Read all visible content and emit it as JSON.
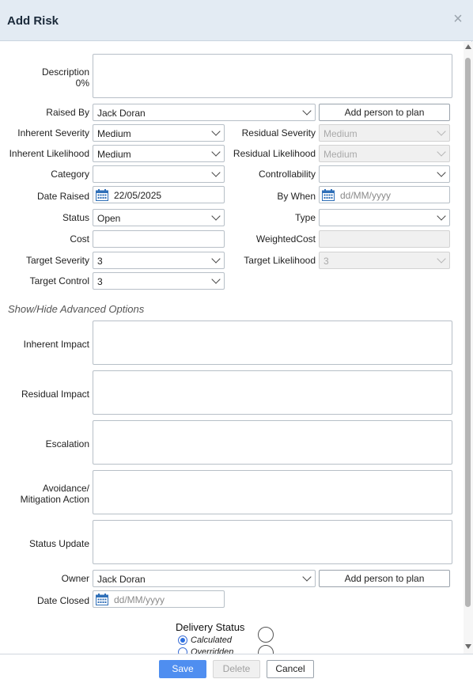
{
  "dialog": {
    "title": "Add Risk",
    "close_glyph": "×"
  },
  "form": {
    "description": {
      "label_line1": "Description",
      "label_line2": "0%",
      "value": ""
    },
    "raised_by": {
      "label": "Raised By",
      "value": "Jack Doran",
      "add_button": "Add person to plan"
    },
    "inherent_severity": {
      "label": "Inherent Severity",
      "value": "Medium"
    },
    "residual_severity": {
      "label": "Residual Severity",
      "value": "Medium"
    },
    "inherent_likelihood": {
      "label": "Inherent Likelihood",
      "value": "Medium"
    },
    "residual_likelihood": {
      "label": "Residual Likelihood",
      "value": "Medium"
    },
    "category": {
      "label": "Category",
      "value": ""
    },
    "controllability": {
      "label": "Controllability",
      "value": ""
    },
    "date_raised": {
      "label": "Date Raised",
      "value": "22/05/2025"
    },
    "by_when": {
      "label": "By When",
      "placeholder": "dd/MM/yyyy"
    },
    "status": {
      "label": "Status",
      "value": "Open"
    },
    "type": {
      "label": "Type",
      "value": ""
    },
    "cost": {
      "label": "Cost",
      "value": ""
    },
    "weighted_cost": {
      "label": "WeightedCost",
      "value": ""
    },
    "target_severity": {
      "label": "Target Severity",
      "value": "3"
    },
    "target_likelihood": {
      "label": "Target Likelihood",
      "value": "3"
    },
    "target_control": {
      "label": "Target Control",
      "value": "3"
    },
    "advanced_toggle": "Show/Hide Advanced Options",
    "inherent_impact": {
      "label": "Inherent Impact"
    },
    "residual_impact": {
      "label": "Residual Impact"
    },
    "escalation": {
      "label": "Escalation"
    },
    "avoidance": {
      "label_line1": "Avoidance/",
      "label_line2": "Mitigation Action"
    },
    "status_update": {
      "label": "Status Update"
    },
    "owner": {
      "label": "Owner",
      "value": "Jack Doran",
      "add_button": "Add person to plan"
    },
    "date_closed": {
      "label": "Date Closed",
      "placeholder": "dd/MM/yyyy"
    },
    "delivery_status": {
      "label": "Delivery Status",
      "option_calculated": "Calculated",
      "option_overridden": "Overridden",
      "selected": "Calculated"
    }
  },
  "footer": {
    "save": "Save",
    "delete": "Delete",
    "cancel": "Cancel"
  },
  "colors": {
    "header_bg": "#e3ebf3",
    "save_bg": "#4f8ef0",
    "calendar_blue": "#2f6fb8",
    "radio_blue": "#2d6fe0"
  },
  "icons": [
    "close-icon",
    "chevron-down-icon",
    "calendar-icon",
    "scroll-up-icon",
    "scroll-down-icon"
  ]
}
